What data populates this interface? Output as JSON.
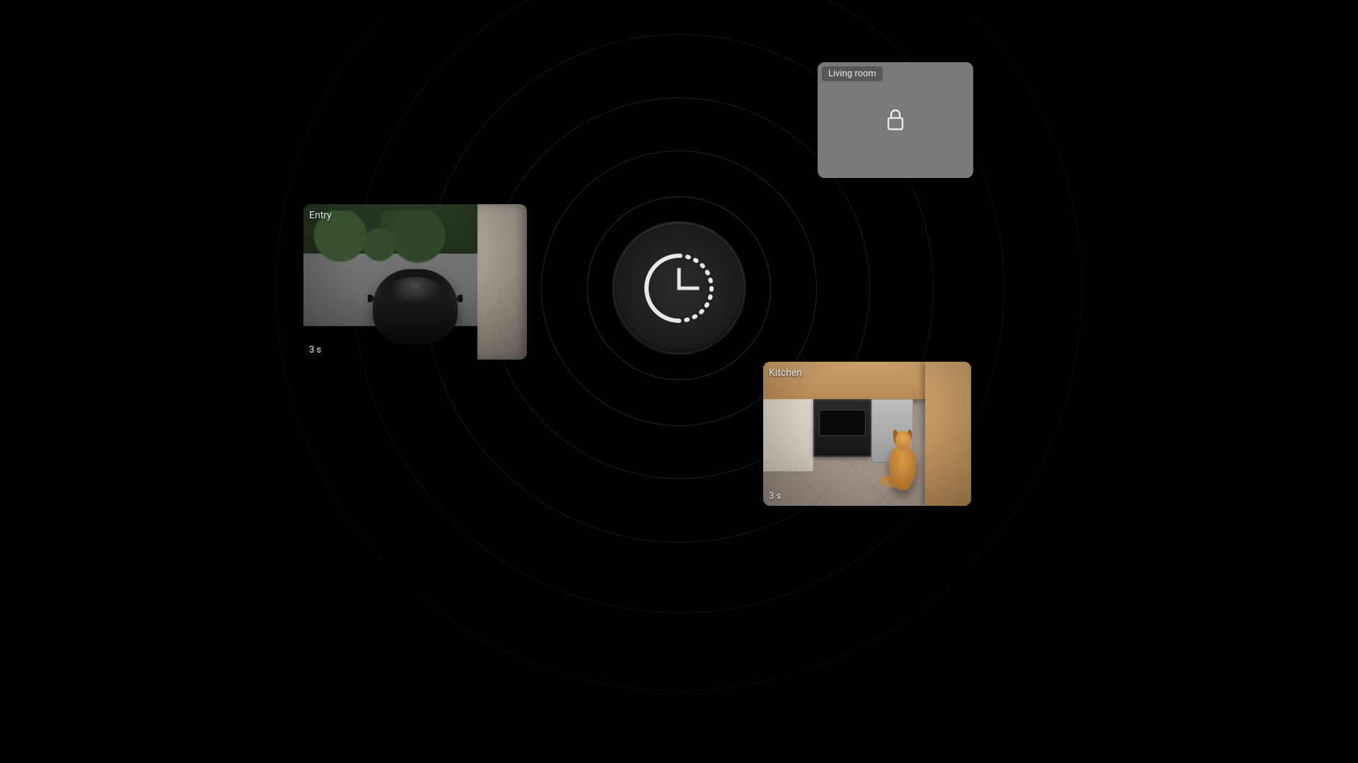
{
  "hub": {
    "icon": "clock-icon"
  },
  "tiles": {
    "entry": {
      "label": "Entry",
      "timestamp": "3 s",
      "locked": false
    },
    "living_room": {
      "label": "Living room",
      "locked": true
    },
    "kitchen": {
      "label": "Kitchen",
      "timestamp": "3 s",
      "locked": false
    }
  },
  "colors": {
    "background": "#000000",
    "tile_locked_bg": "#7a7a7a",
    "text": "#e9e9e9"
  }
}
